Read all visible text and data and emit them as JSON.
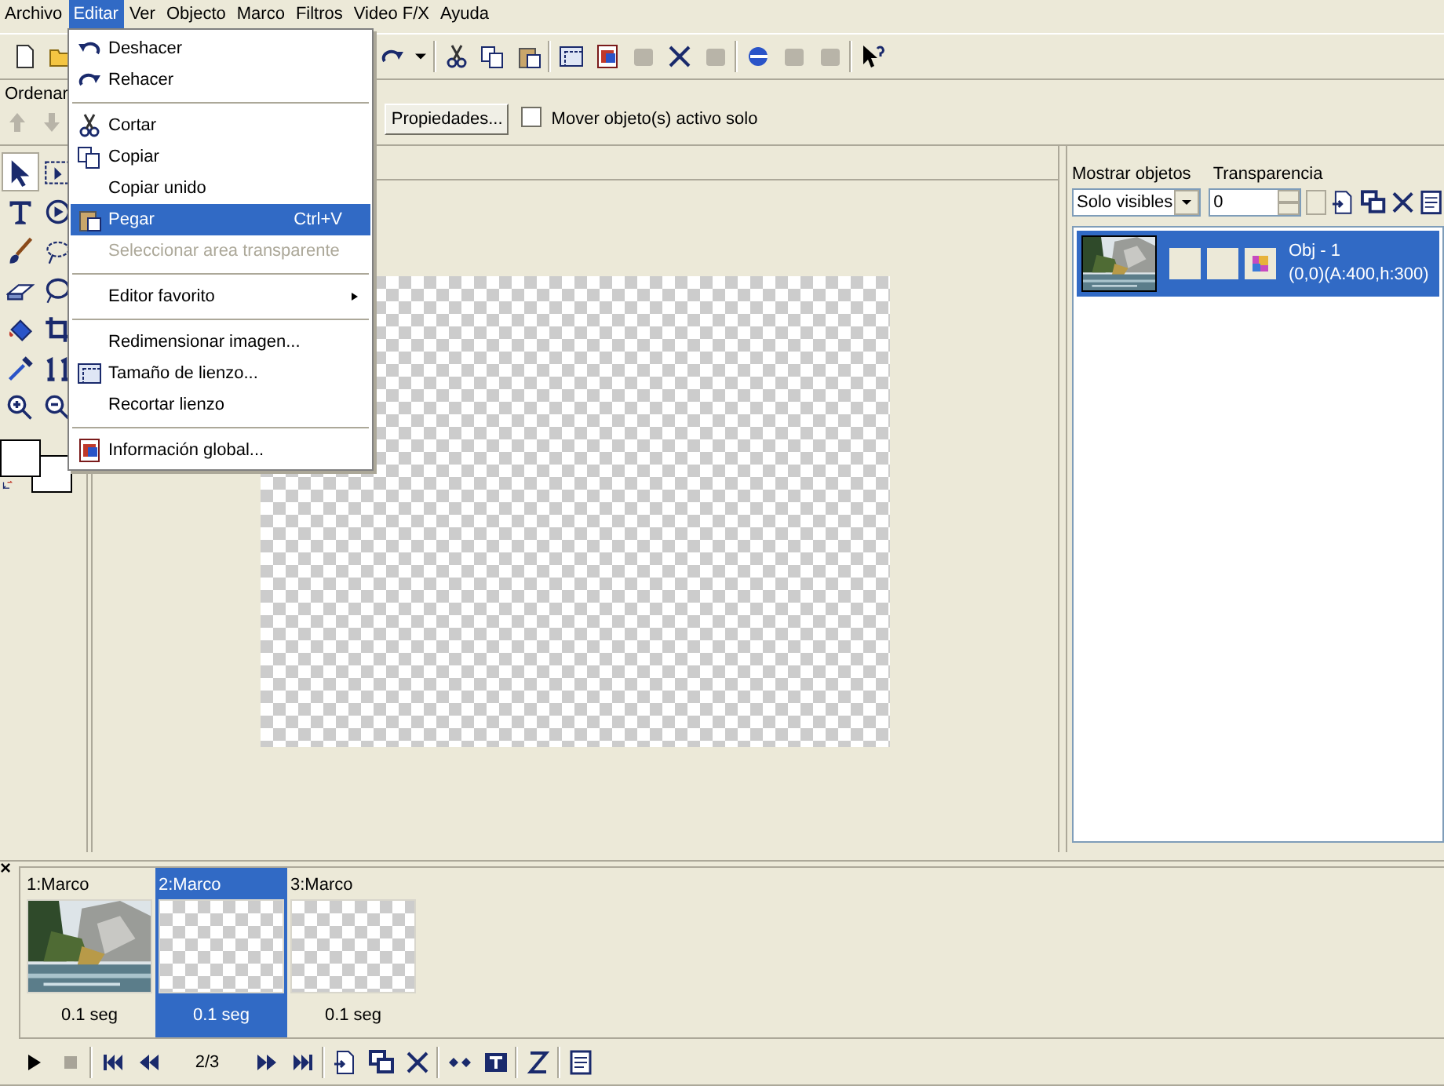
{
  "menu_bar": [
    {
      "label": "Archivo",
      "selected": false
    },
    {
      "label": "Editar",
      "selected": true
    },
    {
      "label": "Ver",
      "selected": false
    },
    {
      "label": "Objecto",
      "selected": false
    },
    {
      "label": "Marco",
      "selected": false
    },
    {
      "label": "Filtros",
      "selected": false
    },
    {
      "label": "Video F/X",
      "selected": false
    },
    {
      "label": "Ayuda",
      "selected": false
    }
  ],
  "edit_menu": [
    {
      "kind": "item",
      "label": "Deshacer",
      "disabled": false,
      "selected": false
    },
    {
      "kind": "item",
      "label": "Rehacer",
      "disabled": false,
      "selected": false
    },
    {
      "kind": "separator"
    },
    {
      "kind": "item",
      "label": "Cortar",
      "disabled": false,
      "selected": false
    },
    {
      "kind": "item",
      "label": "Copiar",
      "disabled": false,
      "selected": false
    },
    {
      "kind": "item",
      "label": "Copiar unido",
      "disabled": false,
      "selected": false
    },
    {
      "kind": "item",
      "label": "Pegar",
      "shortcut": "Ctrl+V",
      "disabled": false,
      "selected": true
    },
    {
      "kind": "item",
      "label": "Seleccionar area transparente",
      "disabled": true,
      "selected": false
    },
    {
      "kind": "separator"
    },
    {
      "kind": "item",
      "label": "Editor favorito",
      "submenu": true,
      "disabled": false,
      "selected": false
    },
    {
      "kind": "separator"
    },
    {
      "kind": "item",
      "label": "Redimensionar imagen...",
      "disabled": false,
      "selected": false
    },
    {
      "kind": "item",
      "label": "Tamaño de lienzo...",
      "disabled": false,
      "selected": false
    },
    {
      "kind": "item",
      "label": "Recortar lienzo",
      "disabled": false,
      "selected": false
    },
    {
      "kind": "separator"
    },
    {
      "kind": "item",
      "label": "Información global...",
      "disabled": false,
      "selected": false
    }
  ],
  "object_toolbar": {
    "order_label": "Ordenar",
    "properties_button": "Propiedades...",
    "move_checkbox": {
      "label": "Mover objeto(s) activo solo",
      "checked": false
    }
  },
  "objects_panel": {
    "show_label": "Mostrar objetos",
    "show_value": "Solo visibles",
    "transparency_label": "Transparencia",
    "transparency_value": "0",
    "objects": [
      {
        "name": "Obj - 1",
        "info": "(0,0)(A:400,h:300)",
        "selected": true
      }
    ]
  },
  "frames_panel": {
    "close": "×",
    "frames": [
      {
        "label": "1:Marco",
        "duration": "0.1 seg",
        "selected": false,
        "kind": "picture"
      },
      {
        "label": "2:Marco",
        "duration": "0.1 seg",
        "selected": true,
        "kind": "transparent"
      },
      {
        "label": "3:Marco",
        "duration": "0.1 seg",
        "selected": false,
        "kind": "transparent"
      }
    ]
  },
  "playback": {
    "position": "2/3"
  }
}
